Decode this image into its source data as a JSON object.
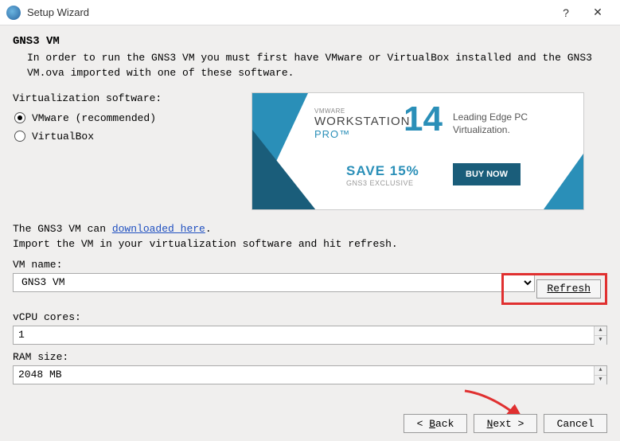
{
  "titlebar": {
    "title": "Setup Wizard"
  },
  "heading": "GNS3 VM",
  "description": "In order to run the GNS3 VM you must first have VMware or VirtualBox installed and the GNS3 VM.ova imported with one of these software.",
  "virt_label": "Virtualization software:",
  "radio": {
    "vmware": "VMware (recommended)",
    "virtualbox": "VirtualBox",
    "selected": "vmware"
  },
  "banner": {
    "small": "VMWARE",
    "workstation": "WORKSTATION",
    "pro": "PRO™",
    "version": "14",
    "lead1": "Leading Edge PC",
    "lead2": "Virtualization.",
    "save": "SAVE 15%",
    "excl": "GNS3 EXCLUSIVE",
    "buy": "BUY NOW"
  },
  "info_prefix": "The GNS3 VM can ",
  "info_link": "downloaded here",
  "info_suffix": ".",
  "info_line2": "Import the VM in your virtualization software and hit refresh.",
  "vm_name_label": "VM name:",
  "vm_name_value": "GNS3 VM",
  "refresh_label": "Refresh",
  "vcpu_label": "vCPU cores:",
  "vcpu_value": "1",
  "ram_label": "RAM size:",
  "ram_value": "2048 MB",
  "buttons": {
    "back": "< Back",
    "next": "Next >",
    "cancel": "Cancel"
  }
}
